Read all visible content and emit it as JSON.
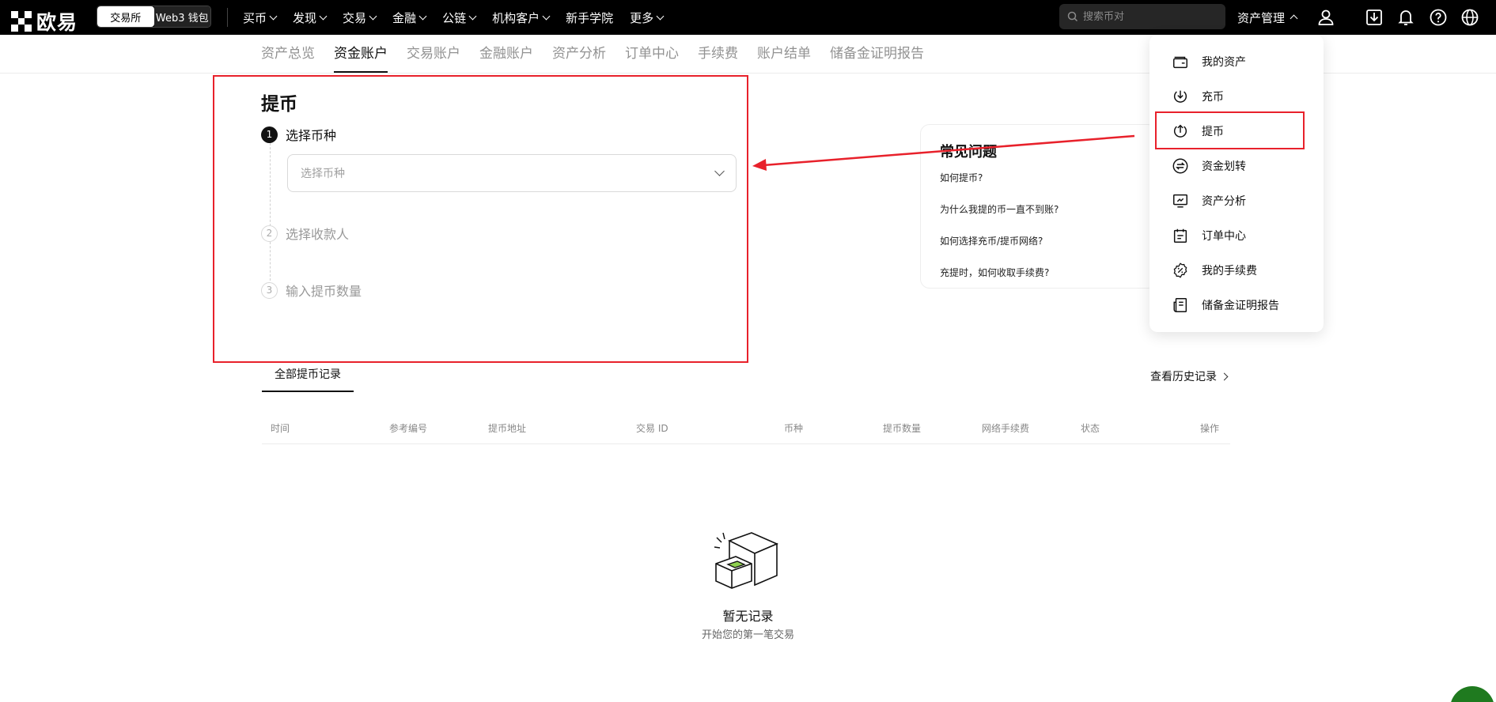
{
  "brand": {
    "name": "欧易"
  },
  "topnav": {
    "toggle": {
      "exchange": "交易所",
      "web3": "Web3 钱包"
    },
    "menu": [
      "买币",
      "发现",
      "交易",
      "金融",
      "公链",
      "机构客户",
      "新手学院",
      "更多"
    ],
    "search_placeholder": "搜索币对",
    "asset_management": "资产管理"
  },
  "subtabs": [
    "资产总览",
    "资金账户",
    "交易账户",
    "金融账户",
    "资产分析",
    "订单中心",
    "手续费",
    "账户结单",
    "储备金证明报告"
  ],
  "withdraw": {
    "title": "提币",
    "steps": [
      {
        "num": "1",
        "label": "选择币种"
      },
      {
        "num": "2",
        "label": "选择收款人"
      },
      {
        "num": "3",
        "label": "输入提币数量"
      }
    ],
    "select_placeholder": "选择币种"
  },
  "faq": {
    "title": "常见问题",
    "items": [
      "如何提币?",
      "为什么我提的币一直不到账?",
      "如何选择充币/提币网络?",
      "充提时，如何收取手续费?"
    ]
  },
  "dropdown": {
    "items": [
      "我的资产",
      "充币",
      "提币",
      "资金划转",
      "资产分析",
      "订单中心",
      "我的手续费",
      "储备金证明报告"
    ]
  },
  "history": {
    "tab": "全部提币记录",
    "view_history": "查看历史记录",
    "columns": [
      "时间",
      "参考编号",
      "提币地址",
      "交易 ID",
      "币种",
      "提币数量",
      "网络手续费",
      "状态",
      "操作"
    ],
    "empty_title": "暂无记录",
    "empty_sub": "开始您的第一笔交易"
  },
  "colors": {
    "annotation": "#e8212b",
    "brand_bg": "#000000",
    "accent_green": "#8fd14f"
  }
}
